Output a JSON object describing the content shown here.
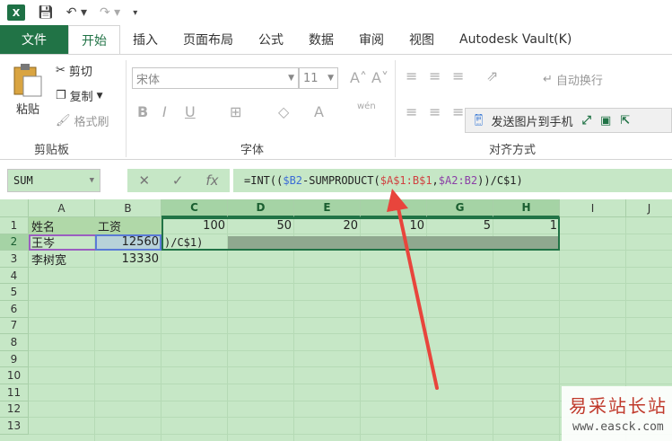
{
  "quick_access": {
    "logo": "X",
    "save_icon": "save-icon",
    "undo_icon": "undo-icon",
    "redo_icon": "redo-icon"
  },
  "tabs": [
    {
      "label": "文件"
    },
    {
      "label": "开始"
    },
    {
      "label": "插入"
    },
    {
      "label": "页面布局"
    },
    {
      "label": "公式"
    },
    {
      "label": "数据"
    },
    {
      "label": "审阅"
    },
    {
      "label": "视图"
    },
    {
      "label": "Autodesk Vault(K)"
    }
  ],
  "ribbon": {
    "clipboard": {
      "paste": "粘贴",
      "cut": "剪切",
      "copy": "复制",
      "format_painter": "格式刷",
      "group_label": "剪贴板"
    },
    "font": {
      "font_name": "宋体",
      "font_size": "11",
      "group_label": "字体",
      "bold": "B",
      "italic": "I",
      "underline": "U",
      "wen": "wén"
    },
    "alignment": {
      "wrap_text": "自动换行",
      "group_label": "对齐方式"
    },
    "float_toolbar": {
      "send_image": "发送图片到手机"
    }
  },
  "formula_bar": {
    "name_box": "SUM",
    "cancel": "✕",
    "enter": "✓",
    "fx": "fx",
    "parts": [
      "=INT((",
      "$B2",
      "-SUMPRODUCT(",
      "$A$1:B$1",
      ",",
      "$A2:B2",
      "))/C$1)"
    ]
  },
  "grid": {
    "columns": [
      "A",
      "B",
      "C",
      "D",
      "E",
      "F",
      "G",
      "H",
      "I",
      "J"
    ],
    "rows": [
      "1",
      "2",
      "3",
      "4",
      "5",
      "6",
      "7",
      "8",
      "9",
      "10",
      "11",
      "12",
      "13"
    ],
    "cells": {
      "A1": "姓名",
      "B1": "工资",
      "C1": "100",
      "D1": "50",
      "E1": "20",
      "F1": "10",
      "G1": "5",
      "H1": "1",
      "A2": "王岑",
      "B2": "12560",
      "C2": ")/C$1)",
      "A3": "李树宽",
      "B3": "13330"
    }
  },
  "watermark": {
    "title": "易采站长站",
    "url": "www.easck.com"
  },
  "colors": {
    "excel_green": "#217346",
    "grid_bg": "#c6e7c6",
    "arrow": "#e8453c"
  }
}
